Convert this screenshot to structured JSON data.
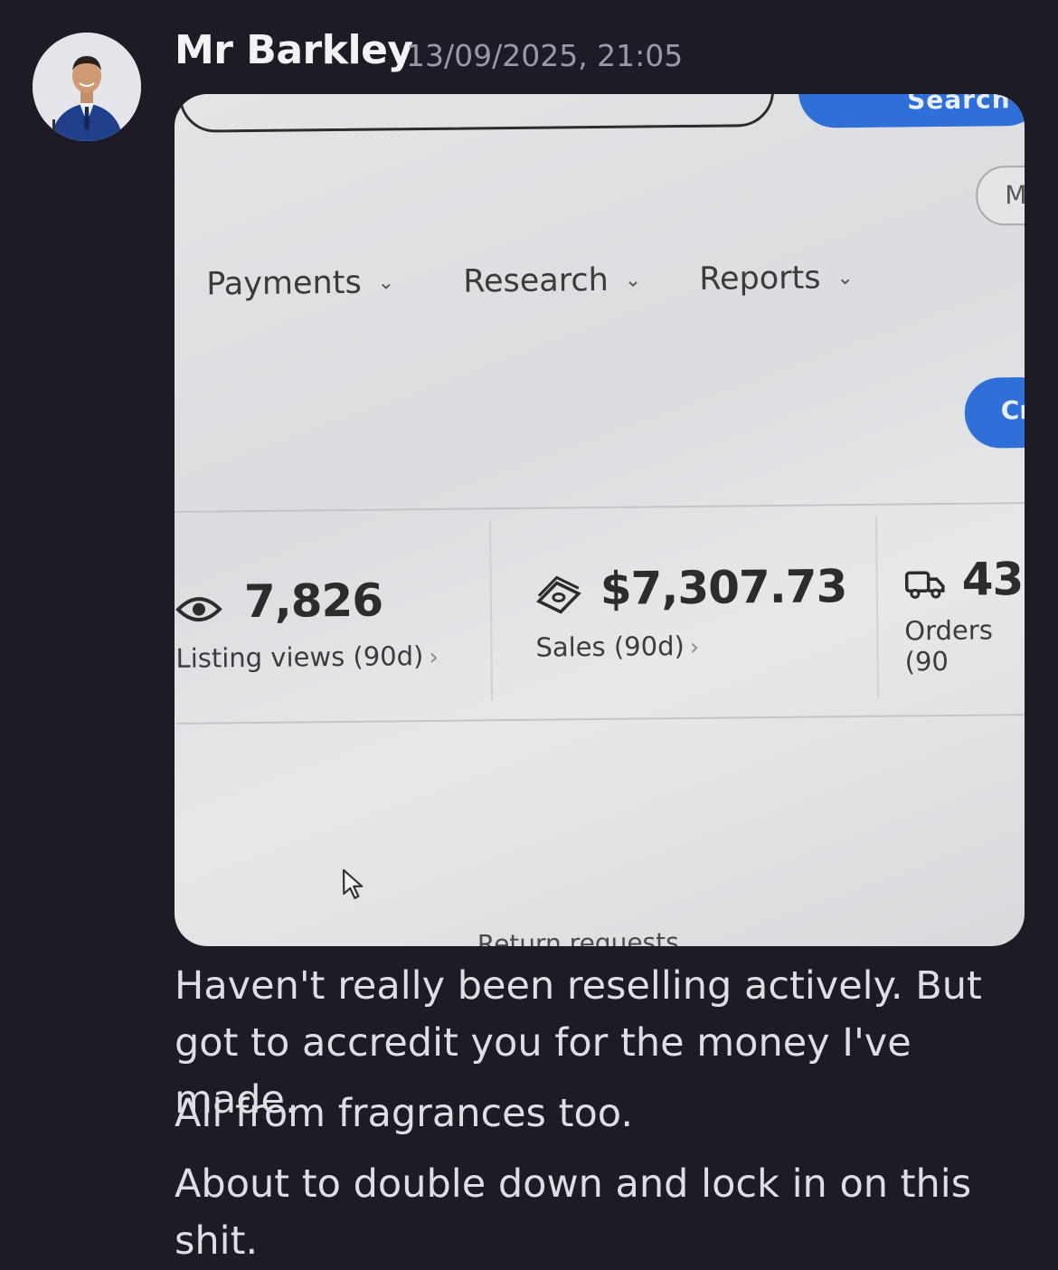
{
  "message": {
    "author": "Mr Barkley",
    "timestamp": "13/09/2025, 21:05",
    "lines": [
      "Haven't really been reselling actively. But got to accredit you for the money I've made.",
      "All from fragrances too.",
      "About to double down and lock in on this shit."
    ]
  },
  "photo": {
    "search_button_label": "Search",
    "pill_label": "M",
    "cta_label": "Cr",
    "nav": [
      {
        "label": "Payments"
      },
      {
        "label": "Research"
      },
      {
        "label": "Reports"
      }
    ],
    "stats": [
      {
        "icon": "eye-icon",
        "value": "7,826",
        "label": "Listing views (90d)"
      },
      {
        "icon": "money-icon",
        "value": "$7,307.73",
        "label": "Sales (90d)"
      },
      {
        "icon": "truck-icon",
        "value": "43",
        "label": "Orders (90"
      }
    ],
    "partial_text": "Return requests"
  },
  "colors": {
    "background": "#1c1b26",
    "accent_blue": "#2f6fd8"
  }
}
